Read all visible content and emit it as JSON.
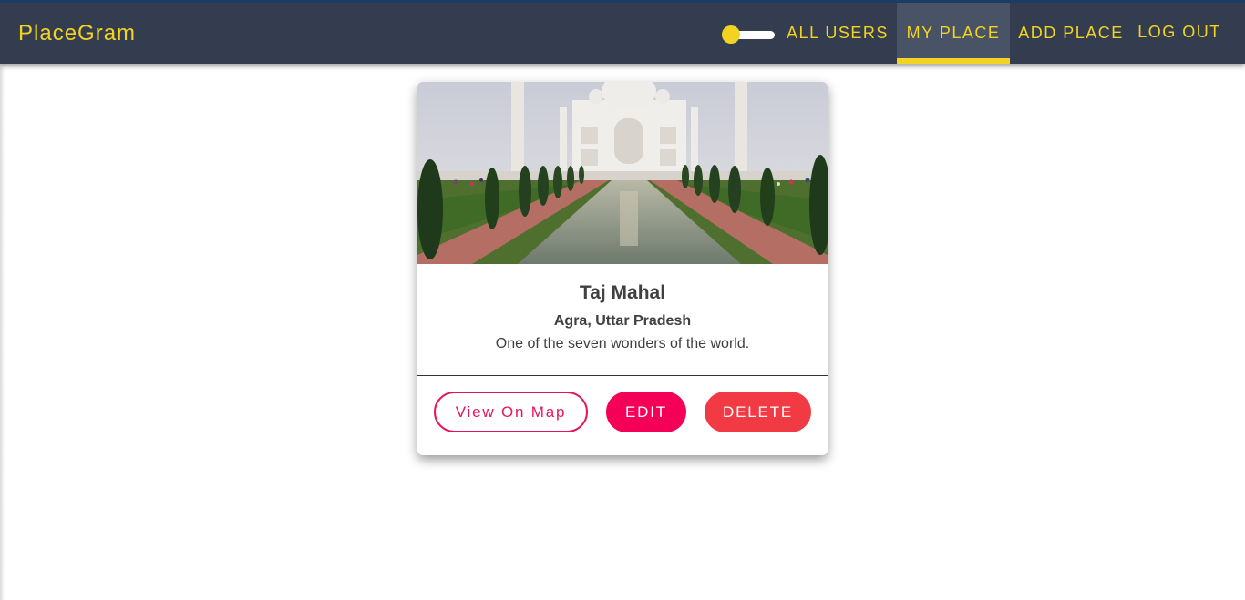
{
  "navbar": {
    "brand": "PlaceGram",
    "items": [
      {
        "label": "ALL USERS",
        "active": false
      },
      {
        "label": "MY PLACE",
        "active": true
      },
      {
        "label": "ADD PLACE",
        "active": false
      },
      {
        "label": "LOG OUT",
        "active": false
      }
    ],
    "theme_toggle": {
      "state": "off"
    }
  },
  "place_card": {
    "image_alt": "Taj Mahal",
    "title": "Taj Mahal",
    "address": "Agra, Uttar Pradesh",
    "description": "One of the seven wonders of the world.",
    "buttons": {
      "view_map": "View On Map",
      "edit": "EDIT",
      "delete": "DELETE"
    }
  },
  "colors": {
    "navbar_bg": "#343d4f",
    "accent_yellow": "#f3d321",
    "edit_pink": "#f50057",
    "delete_red": "#f23a44"
  }
}
